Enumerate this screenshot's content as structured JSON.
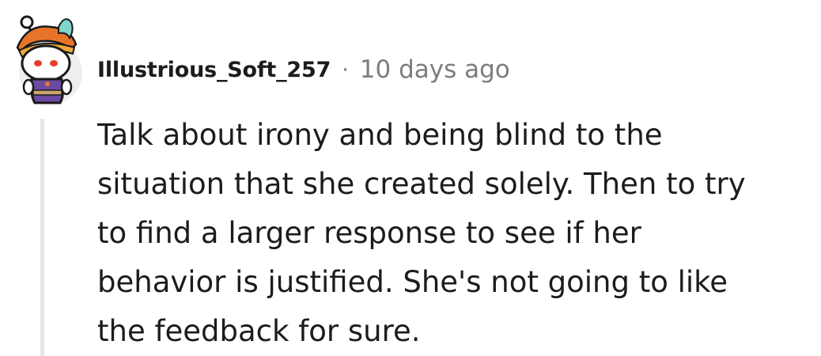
{
  "comment": {
    "avatar_icon": "snoo-avatar-icon",
    "username": "Illustrious_Soft_257",
    "separator": "·",
    "timestamp": "10 days ago",
    "body_lines": [
      "Talk about irony and being blind to the",
      "situation that she created solely. Then to try",
      "to find a larger response to see if her",
      "behavior is justified. She's not going to like",
      "the feedback for sure."
    ]
  },
  "colors": {
    "text": "#1c1c1c",
    "meta": "#7c7c7c",
    "thread_line": "#e5e5e5"
  }
}
